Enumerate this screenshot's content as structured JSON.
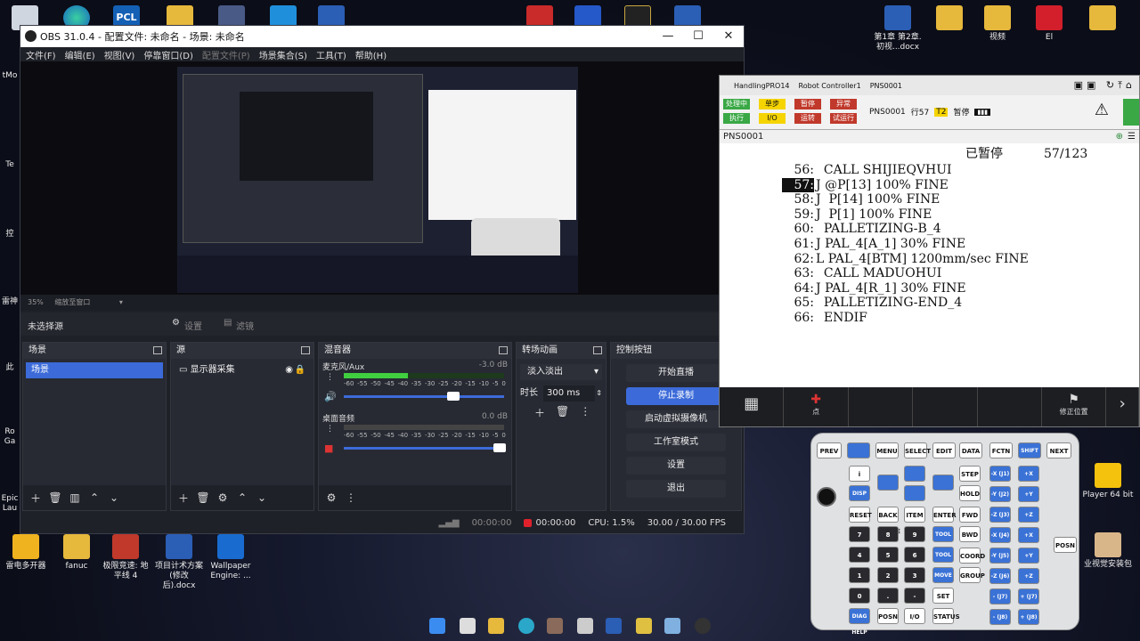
{
  "desktop": {
    "left_icons": [
      {
        "label": "tMo"
      },
      {
        "label": "Te"
      },
      {
        "label": "控"
      },
      {
        "label": "雷神"
      },
      {
        "label": "此"
      },
      {
        "label": "Ro\nGa"
      },
      {
        "label": "Epic\nLau"
      }
    ],
    "top_icons": [
      {
        "label": "PCL"
      }
    ],
    "right_icons": [
      {
        "label": "第1章 第2章. 初视...docx"
      },
      {
        "label": "视频"
      },
      {
        "label": "El"
      },
      {
        "label": "Player 64 bit"
      },
      {
        "label": "业视觉安装包"
      }
    ],
    "bottom_icons": [
      {
        "label": "雷电多开器"
      },
      {
        "label": "fanuc"
      },
      {
        "label": "极限竞速: 地平线 4"
      },
      {
        "label": "项目计术方案(修改后).docx"
      },
      {
        "label": "Wallpaper Engine: ..."
      }
    ],
    "colors": {
      "accent": "#3c6bd9",
      "record": "#e0212c"
    }
  },
  "obs": {
    "title": "OBS 31.0.4 - 配置文件: 未命名 - 场景: 未命名",
    "menu": [
      "文件(F)",
      "编辑(E)",
      "视图(V)",
      "停靠窗口(D)",
      "配置文件(P)",
      "场景集合(S)",
      "工具(T)",
      "帮助(H)"
    ],
    "zoom": "35%",
    "zoom_label": "缩放至窗口",
    "no_source": "未选择源",
    "settings_btn": "设置",
    "filter_btn": "滤镜",
    "docks": {
      "scenes": {
        "title": "场景",
        "items": [
          "场景"
        ]
      },
      "sources": {
        "title": "源",
        "items": [
          "显示器采集"
        ]
      },
      "mixer": {
        "title": "混音器",
        "channels": [
          {
            "name": "麦克风/Aux",
            "db": "-3.0 dB",
            "level": 0.62
          },
          {
            "name": "桌面音频",
            "db": "0.0 dB",
            "level": 0.98
          }
        ],
        "scale": [
          "-60",
          "-55",
          "-50",
          "-45",
          "-40",
          "-35",
          "-30",
          "-25",
          "-20",
          "-15",
          "-10",
          "-5",
          "0"
        ]
      },
      "transitions": {
        "title": "转场动画",
        "type": "淡入淡出",
        "duration_label": "时长",
        "duration": "300 ms"
      },
      "controls": {
        "title": "控制按钮",
        "buttons": [
          "开始直播",
          "停止录制",
          "启动虚拟摄像机",
          "工作室模式",
          "设置",
          "退出"
        ]
      }
    },
    "status": {
      "time1": "00:00:00",
      "time2": "00:00:00",
      "cpu": "CPU: 1.5%",
      "fps": "30.00 / 30.00 FPS"
    }
  },
  "robot": {
    "app": "HandlingPRO14",
    "controller": "Robot Controller1",
    "prog_name": "PNS0001",
    "status_leds": [
      {
        "label": "处理中",
        "color": "#39a845"
      },
      {
        "label": "单步",
        "color": "#f5d400"
      },
      {
        "label": "暂停",
        "color": "#c0392b"
      },
      {
        "label": "异常",
        "color": "#c0392b"
      },
      {
        "label": "执行",
        "color": "#39a845"
      },
      {
        "label": "I/O",
        "color": "#f5d400"
      },
      {
        "label": "运转",
        "color": "#c0392b"
      },
      {
        "label": "试运行",
        "color": "#c0392b"
      }
    ],
    "status_line": {
      "prog": "PNS0001",
      "line": "行57",
      "t2": "T2",
      "state": "暂停"
    },
    "pns_label": "PNS0001",
    "header_state": "已暂停",
    "header_pos": "57/123",
    "lines": [
      {
        "num": "56:",
        "text": "  CALL SHIJIEQVHUI"
      },
      {
        "num": "57:",
        "text": "J @P[13] 100% FINE",
        "current": true
      },
      {
        "num": "58:",
        "text": "J  P[14] 100% FINE"
      },
      {
        "num": "59:",
        "text": "J  P[1] 100% FINE"
      },
      {
        "num": "60:",
        "text": "  PALLETIZING-B_4"
      },
      {
        "num": "61:",
        "text": "J PAL_4[A_1] 30% FINE"
      },
      {
        "num": "62:",
        "text": "L PAL_4[BTM] 1200mm/sec FINE"
      },
      {
        "num": "63:",
        "text": "  CALL MADUOHUI"
      },
      {
        "num": "64:",
        "text": "J PAL_4[R_1] 30% FINE"
      },
      {
        "num": "65:",
        "text": "  PALLETIZING-END_4"
      },
      {
        "num": "66:",
        "text": "  ENDIF"
      }
    ],
    "footer": [
      "点",
      "修正位置"
    ]
  },
  "keypad": {
    "row1": [
      "PREV",
      "",
      "MENU",
      "SELECT",
      "EDIT",
      "DATA",
      "FCTN",
      "SHIFT",
      "NEXT"
    ],
    "nav": [
      "i",
      "DISP",
      "RESET",
      "BACK SPACE",
      "ITEM",
      "ENTER",
      "STEP",
      "HOLD",
      "FWD",
      "BWD",
      "COORD",
      "GROUP"
    ],
    "digits": [
      "7",
      "8",
      "9",
      "4",
      "5",
      "6",
      "1",
      "2",
      "3",
      "0",
      ".",
      "-"
    ],
    "tool": [
      "TOOL 1",
      "TOOL 2",
      "MOVE MENU",
      "SET UP",
      "DIAG HELP",
      "POSN",
      "I/O",
      "STATUS"
    ],
    "jog": [
      "-X (J1)",
      "+X (J1)",
      "-Y (J2)",
      "+Y (J2)",
      "-Z (J3)",
      "+Z (J3)",
      "-X (J4)",
      "+X (J4)",
      "-Y (J5)",
      "+Y (J5)",
      "-Z (J6)",
      "+Z (J6)",
      "- (J7)",
      "+ (J7)",
      "- (J8)",
      "+ (J8)"
    ],
    "posn": "POSN"
  }
}
